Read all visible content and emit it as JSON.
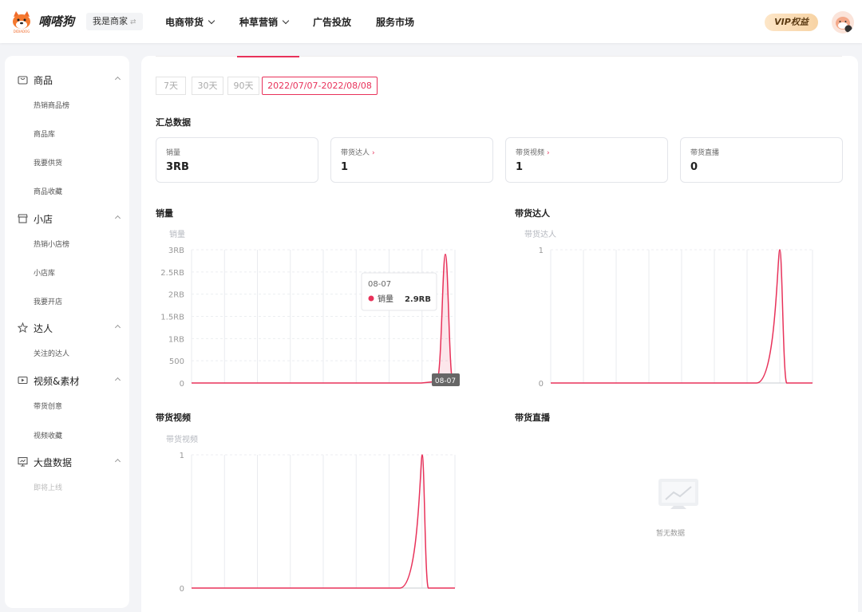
{
  "header": {
    "brand": "嘀嗒狗",
    "merchant_toggle": "我是商家",
    "nav": [
      {
        "label": "电商带货",
        "has_menu": true
      },
      {
        "label": "种草营销",
        "has_menu": true
      },
      {
        "label": "广告投放",
        "has_menu": false
      },
      {
        "label": "服务市场",
        "has_menu": false
      }
    ],
    "vip_label": "VIP权益"
  },
  "sidebar": {
    "groups": [
      {
        "label": "商品",
        "icon": "shopping-bag-icon",
        "items": [
          "热销商品榜",
          "商品库",
          "我要供货",
          "商品收藏"
        ]
      },
      {
        "label": "小店",
        "icon": "store-icon",
        "items": [
          "热销小店榜",
          "小店库",
          "我要开店"
        ]
      },
      {
        "label": "达人",
        "icon": "star-person-icon",
        "items": [
          "关注的达人"
        ]
      },
      {
        "label": "视频&素材",
        "icon": "video-icon",
        "items": [
          "带货创意",
          "视频收藏"
        ]
      },
      {
        "label": "大盘数据",
        "icon": "monitor-chart-icon",
        "items": [
          "即将上线"
        ]
      }
    ]
  },
  "date_ranges": [
    {
      "label": "7天",
      "active": false
    },
    {
      "label": "30天",
      "active": false
    },
    {
      "label": "90天",
      "active": false
    },
    {
      "label": "2022/07/07-2022/08/08",
      "active": true
    }
  ],
  "summary": {
    "title": "汇总数据",
    "cards": [
      {
        "label": "销量",
        "value": "3RB",
        "link": false
      },
      {
        "label": "带货达人",
        "value": "1",
        "link": true
      },
      {
        "label": "带货视频",
        "value": "1",
        "link": true
      },
      {
        "label": "带货直播",
        "value": "0",
        "link": false
      }
    ]
  },
  "colors": {
    "accent": "#e8325a",
    "line": "#e8325a"
  },
  "chart_data": [
    {
      "type": "line",
      "title": "销量",
      "series": [
        {
          "name": "销量",
          "peak_x": "08-07",
          "peak_value": 2900
        }
      ],
      "ylabel": "销量",
      "yticks": [
        "0",
        "500",
        "1RB",
        "1.5RB",
        "2RB",
        "2.5RB",
        "3RB"
      ],
      "ylim": [
        0,
        3000
      ],
      "grid": true,
      "tooltip": {
        "date": "08-07",
        "series": "销量",
        "value": "2.9RB"
      },
      "x_marker": "08-07"
    },
    {
      "type": "line",
      "title": "带货达人",
      "series": [
        {
          "peak_value": 1
        }
      ],
      "ylabel": "带货达人",
      "yticks": [
        "0",
        "1"
      ],
      "ylim": [
        0,
        1
      ],
      "grid": true
    },
    {
      "type": "line",
      "title": "带货视频",
      "series": [
        {
          "peak_value": 1
        }
      ],
      "ylabel": "带货视频",
      "yticks": [
        "0",
        "1"
      ],
      "ylim": [
        0,
        1
      ],
      "grid": true
    },
    {
      "type": "line",
      "title": "带货直播",
      "empty": true,
      "empty_text": "暂无数据"
    }
  ]
}
